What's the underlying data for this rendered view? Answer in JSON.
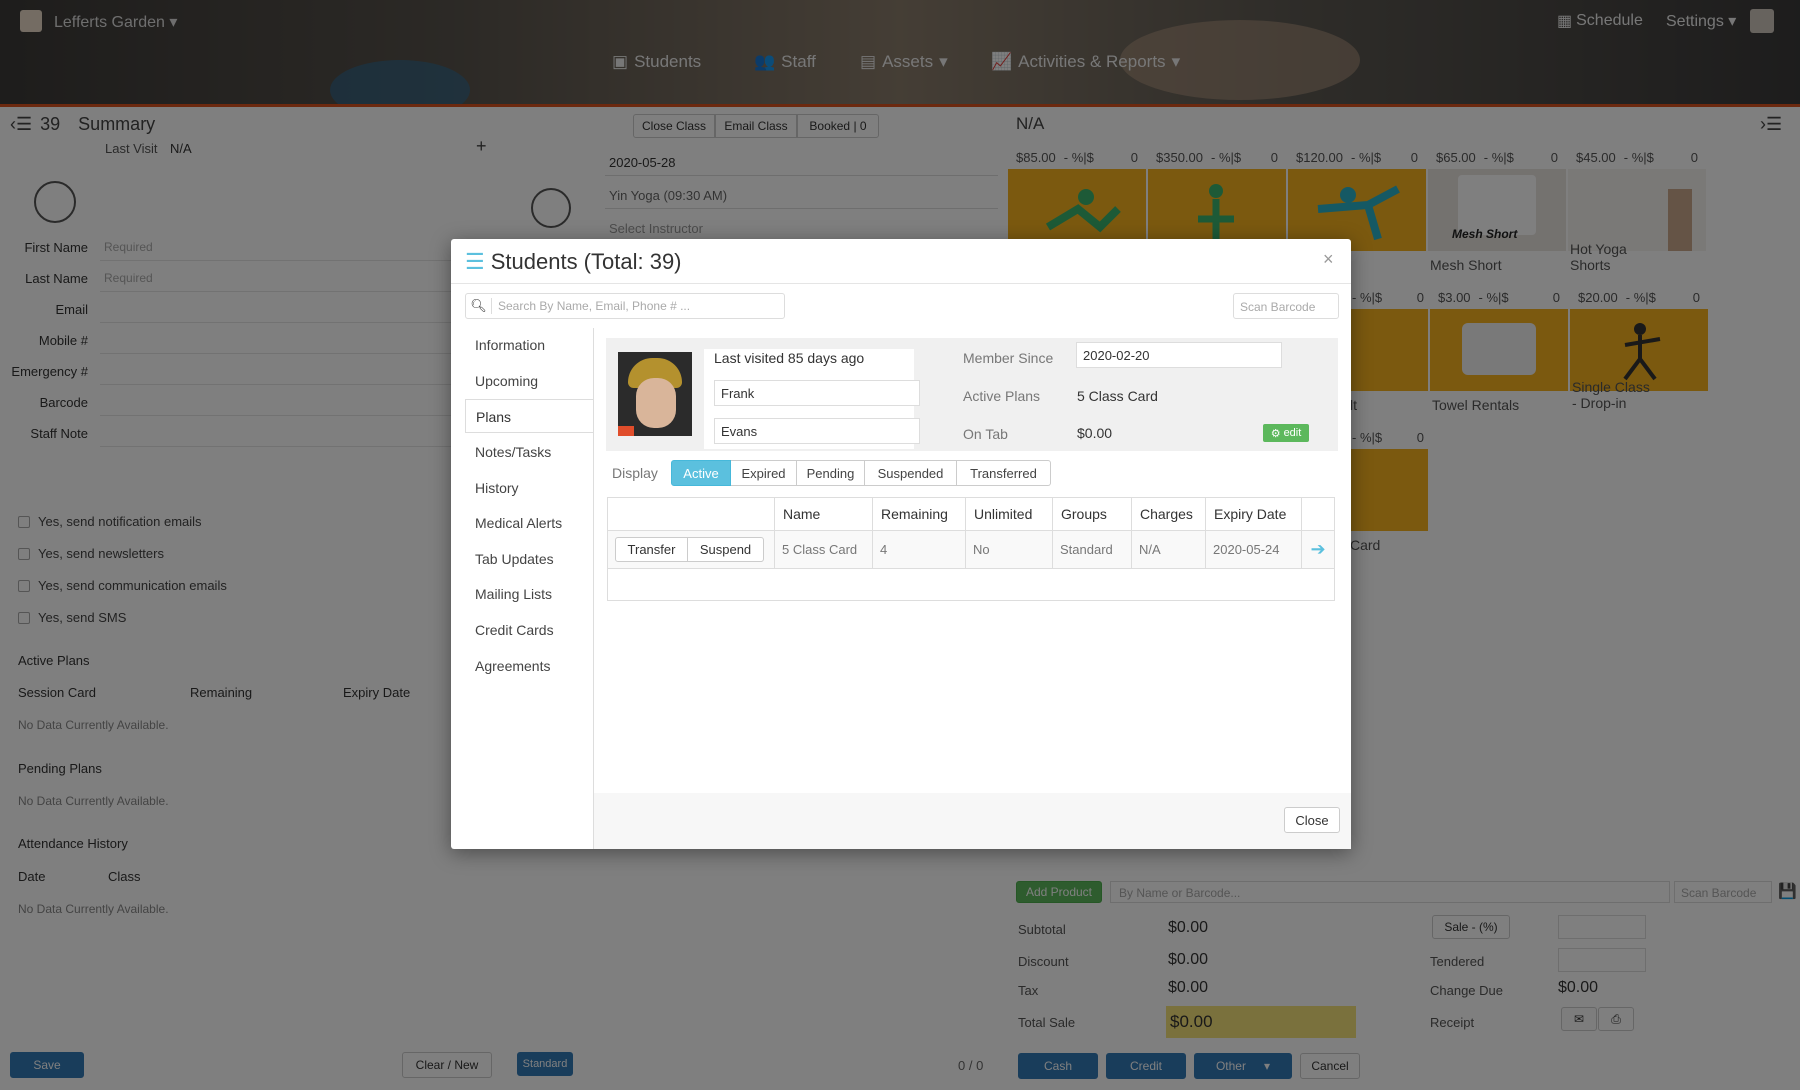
{
  "topbar": {
    "studio_name": "Lefferts Garden",
    "schedule_label": "Schedule",
    "settings_label": "Settings",
    "nav": [
      "Students",
      "Staff",
      "Assets",
      "Activities & Reports"
    ]
  },
  "left_panel": {
    "count": "39",
    "title": "Summary",
    "last_visit_label": "Last Visit",
    "last_visit_value": "N/A",
    "fields": [
      {
        "label": "First Name",
        "placeholder": "Required"
      },
      {
        "label": "Last Name",
        "placeholder": "Required"
      },
      {
        "label": "Email",
        "placeholder": ""
      },
      {
        "label": "Mobile #",
        "placeholder": ""
      },
      {
        "label": "Emergency #",
        "placeholder": ""
      },
      {
        "label": "Barcode",
        "placeholder": ""
      },
      {
        "label": "Staff Note",
        "placeholder": ""
      }
    ],
    "checkboxes": [
      "Yes, send notification emails",
      "Yes, send newsletters",
      "Yes, send communication emails",
      "Yes, send SMS"
    ],
    "active_plans_title": "Active Plans",
    "active_plans_cols": [
      "Session Card",
      "Remaining",
      "Expiry Date"
    ],
    "no_data": "No Data Currently Available.",
    "pending_plans_title": "Pending Plans",
    "attendance_title": "Attendance History",
    "attendance_cols": [
      "Date",
      "Class"
    ],
    "save_label": "Save",
    "clear_label": "Clear / New"
  },
  "middle_panel": {
    "buttons": [
      "Close Class",
      "Email Class",
      "Booked | 0"
    ],
    "date": "2020-05-28",
    "class_select": "Yin Yoga (09:30 AM)",
    "instructor_placeholder": "Select Instructor",
    "standard_label": "Standard",
    "counter": "0 / 0"
  },
  "right_panel": {
    "title": "N/A",
    "products_row1": [
      {
        "price": "$85.00",
        "pct": "- %|$",
        "qty": "0",
        "name": ""
      },
      {
        "price": "$350.00",
        "pct": "- %|$",
        "qty": "0",
        "name": ""
      },
      {
        "price": "$120.00",
        "pct": "- %|$",
        "qty": "0",
        "name": ""
      },
      {
        "price": "$65.00",
        "pct": "- %|$",
        "qty": "0",
        "name": "Mesh Short"
      },
      {
        "price": "$45.00",
        "pct": "- %|$",
        "qty": "0",
        "name": "Hot Yoga Shorts"
      }
    ],
    "products_row2": [
      {
        "price": "",
        "pct": "- %|$",
        "qty": "0",
        "name": "lt"
      },
      {
        "price": "$3.00",
        "pct": "- %|$",
        "qty": "0",
        "name": "Towel Rentals"
      },
      {
        "price": "$20.00",
        "pct": "- %|$",
        "qty": "0",
        "name": "Single Class - Drop-in"
      }
    ],
    "product_row3": {
      "pct": "- %|$",
      "qty": "0",
      "name": "Card"
    },
    "mesh_short_caption": "Mesh Short",
    "add_product": "Add Product",
    "search_placeholder": "By Name or Barcode...",
    "scan_barcode": "Scan Barcode",
    "subtotal_label": "Subtotal",
    "subtotal": "$0.00",
    "discount_label": "Discount",
    "discount": "$0.00",
    "tax_label": "Tax",
    "tax": "$0.00",
    "total_label": "Total Sale",
    "total": "$0.00",
    "sale_pct": "Sale - (%)",
    "tendered_label": "Tendered",
    "change_due_label": "Change Due",
    "change_due": "$0.00",
    "receipt_label": "Receipt",
    "pay_buttons": [
      "Cash",
      "Credit",
      "Other"
    ],
    "cancel_label": "Cancel"
  },
  "modal": {
    "title": "Students (Total: 39)",
    "search_placeholder": "Search By Name, Email, Phone # ...",
    "scan_placeholder": "Scan Barcode",
    "tabs": [
      "Information",
      "Upcoming",
      "Plans",
      "Notes/Tasks",
      "History",
      "Medical Alerts",
      "Tab Updates",
      "Mailing Lists",
      "Credit Cards",
      "Agreements"
    ],
    "active_tab": "Plans",
    "last_visited": "Last visited 85 days ago",
    "first_name": "Frank",
    "last_name": "Evans",
    "member_since_label": "Member Since",
    "member_since": "2020-02-20",
    "active_plans_label": "Active Plans",
    "active_plans": "5 Class Card",
    "on_tab_label": "On Tab",
    "on_tab": "$0.00",
    "edit_label": "edit",
    "display_label": "Display",
    "filters": [
      "Active",
      "Expired",
      "Pending",
      "Suspended",
      "Transferred"
    ],
    "table_headers": [
      "",
      "Name",
      "Remaining",
      "Unlimited",
      "Groups",
      "Charges",
      "Expiry Date",
      ""
    ],
    "row": {
      "transfer": "Transfer",
      "suspend": "Suspend",
      "name": "5 Class Card",
      "remaining": "4",
      "unlimited": "No",
      "groups": "Standard",
      "charges": "N/A",
      "expiry": "2020-05-24"
    },
    "close_label": "Close",
    "close_x": "×"
  },
  "colors": {
    "accent": "#5bc0de",
    "green": "#5cb85c",
    "orange": "#d9531e",
    "product": "#f6b21e"
  }
}
